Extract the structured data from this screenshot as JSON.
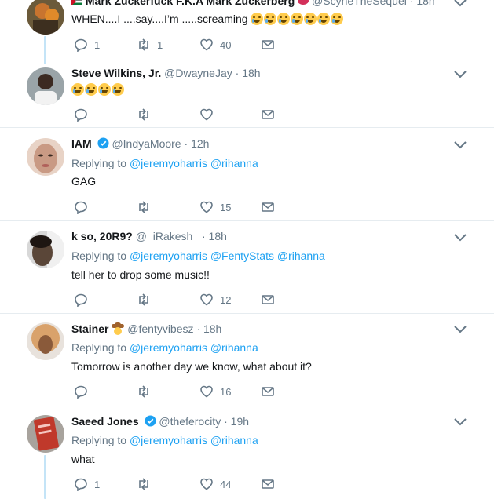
{
  "tweets": [
    {
      "name": "Mark Zuckerfuck F.K.A Mark Zuckerberg",
      "handle": "@ScyneTheSequel",
      "time": "18h",
      "text": "WHEN....I ....say....I’m .....screaming",
      "emoji_count": 7,
      "replies": "1",
      "retweets": "1",
      "likes": "40",
      "avatar_color": "#6b5a3a"
    },
    {
      "name": "Steve Wilkins, Jr.",
      "handle": "@DwayneJay",
      "time": "18h",
      "emoji_count": 4,
      "replies": "",
      "retweets": "",
      "likes": "",
      "avatar_color": "#3b2a22"
    },
    {
      "name": "IAM",
      "verified": true,
      "handle": "@IndyaMoore",
      "time": "12h",
      "replying_label": "Replying to",
      "mentions": [
        "@jeremyoharris",
        "@rihanna"
      ],
      "text": "GAG",
      "replies": "",
      "retweets": "",
      "likes": "15",
      "avatar_color": "#c99a84"
    },
    {
      "name": "k so, 20R9?",
      "handle": "@_iRakesh_",
      "time": "18h",
      "replying_label": "Replying to",
      "mentions": [
        "@jeremyoharris",
        "@FentyStats",
        "@rihanna"
      ],
      "text": "tell her to drop some music!!",
      "replies": "",
      "retweets": "",
      "likes": "12",
      "avatar_color": "#5a4638"
    },
    {
      "name": "Stainer",
      "handle": "@fentyvibesz",
      "time": "18h",
      "replying_label": "Replying to",
      "mentions": [
        "@jeremyoharris",
        "@rihanna"
      ],
      "text": "Tomorrow is another day we know, what about it?",
      "replies": "",
      "retweets": "",
      "likes": "16",
      "avatar_color": "#d9a26b"
    },
    {
      "name": "Saeed Jones",
      "verified": true,
      "handle": "@theferocity",
      "time": "19h",
      "replying_label": "Replying to",
      "mentions": [
        "@jeremyoharris",
        "@rihanna"
      ],
      "text": "what",
      "replies": "1",
      "retweets": "",
      "likes": "44",
      "avatar_color": "#c0392b"
    }
  ],
  "colors": {
    "link": "#1da1f2",
    "muted": "#657786",
    "thread_line": "#c4e4f7",
    "separator": "#e6ecf0"
  },
  "icons": [
    "reply-icon",
    "retweet-icon",
    "like-icon",
    "message-icon",
    "chevron-down-icon",
    "verified-badge-icon",
    "crying-laughing-emoji",
    "loudly-crying-emoji"
  ]
}
